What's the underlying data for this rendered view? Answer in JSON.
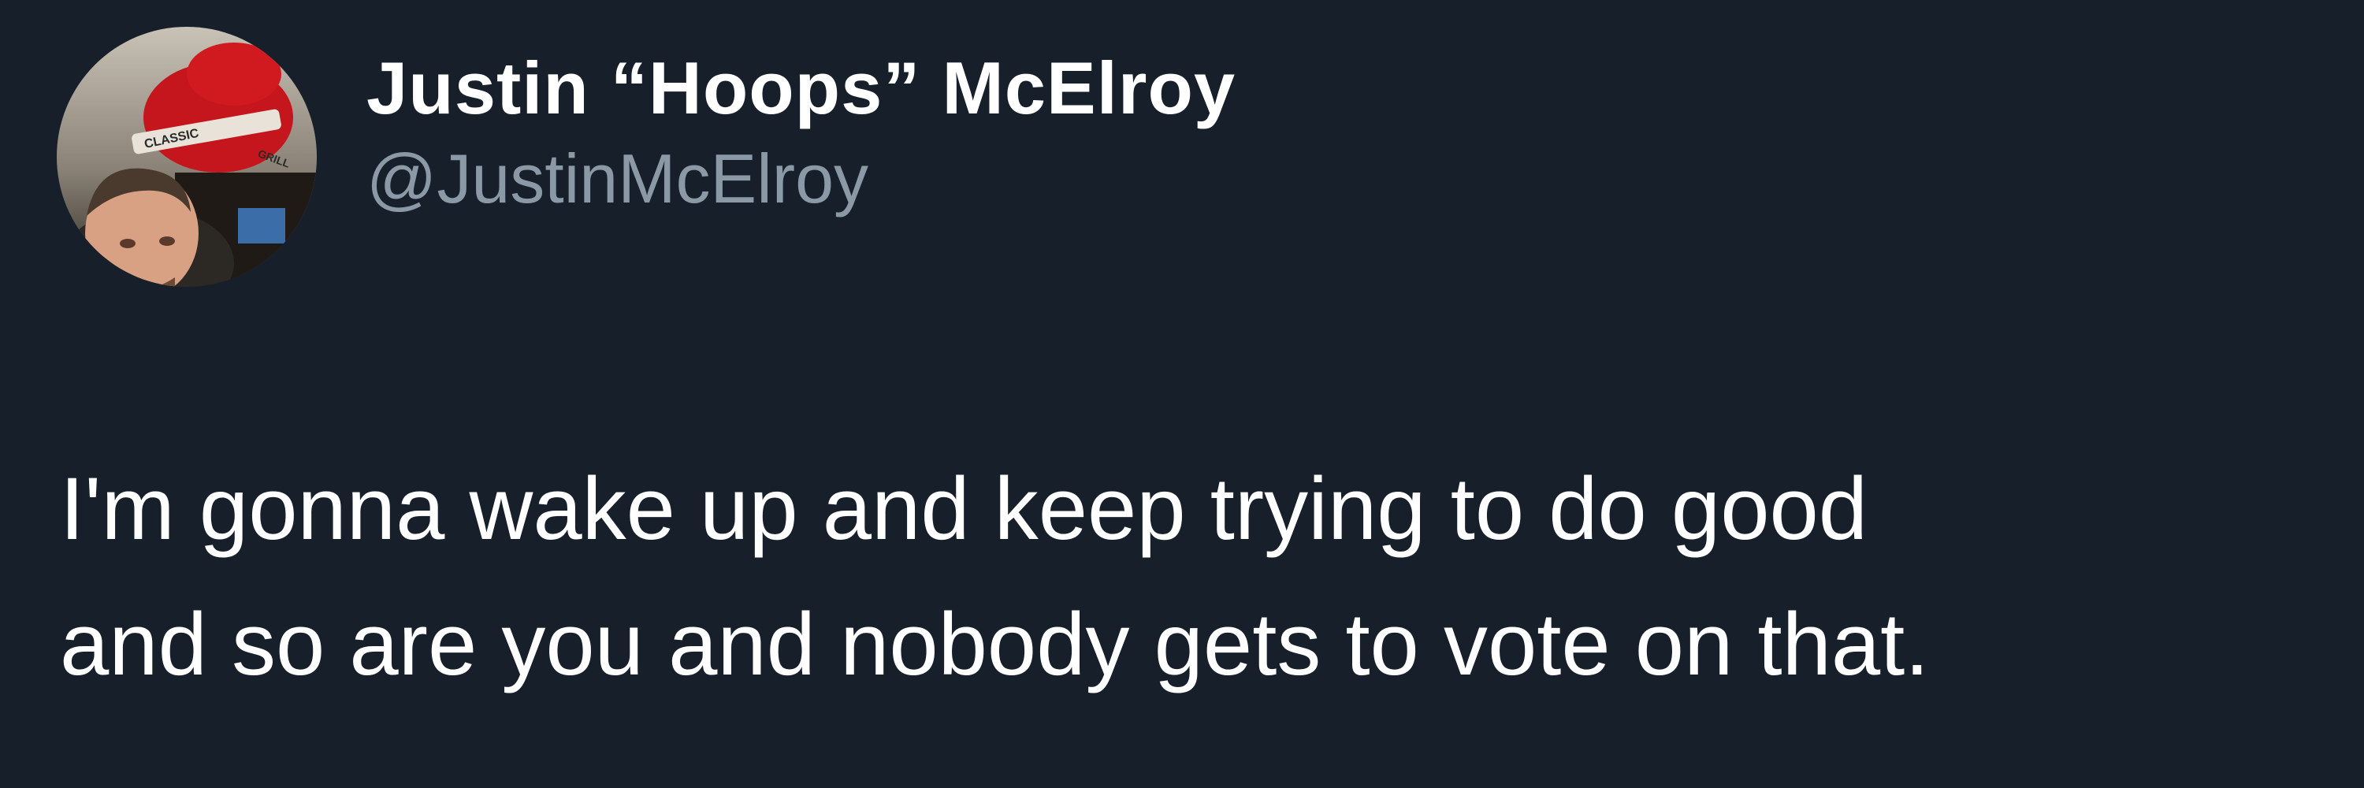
{
  "author": {
    "display_name": "Justin “Hoops” McElroy",
    "handle": "@JustinMcElroy",
    "avatar": {
      "description_icon": "profile-photo",
      "sign_text": [
        "CLASSIC",
        "GRILL"
      ]
    }
  },
  "tweet": {
    "lines": [
      "I'm gonna wake up and keep trying to do good",
      "and so are you and nobody gets to vote on that."
    ]
  },
  "colors": {
    "background": "#17202a",
    "name": "#ffffff",
    "handle": "#8b98a5",
    "text": "#ffffff"
  }
}
